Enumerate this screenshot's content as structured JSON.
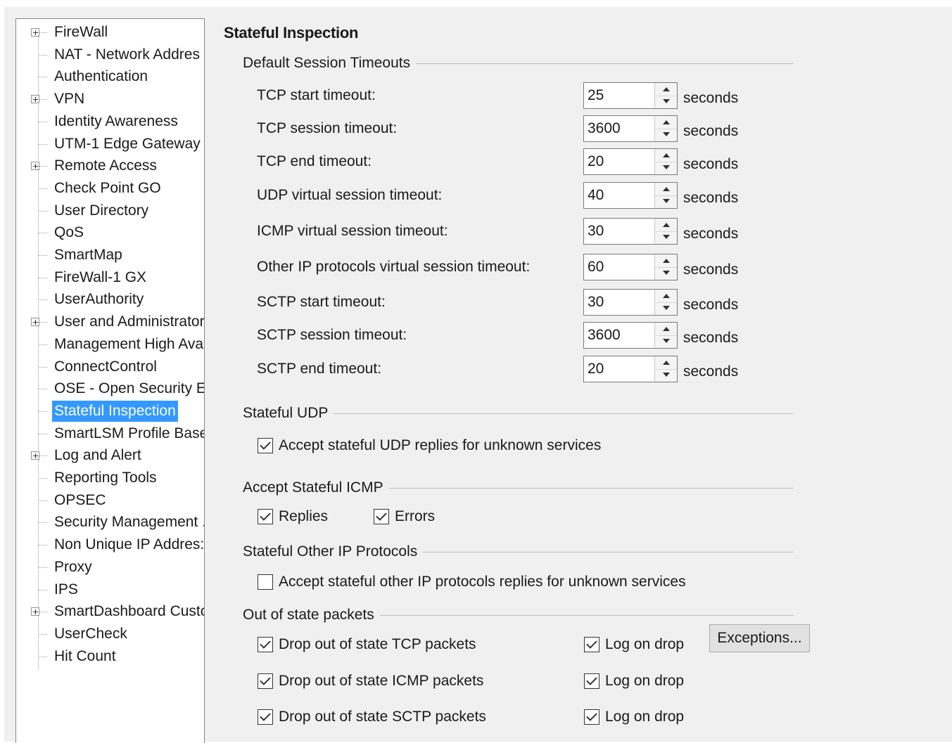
{
  "tree": {
    "items": [
      {
        "label": "FireWall",
        "expandable": true
      },
      {
        "label": "NAT - Network Addres",
        "expandable": false
      },
      {
        "label": "Authentication",
        "expandable": false
      },
      {
        "label": "VPN",
        "expandable": true
      },
      {
        "label": "Identity Awareness",
        "expandable": false
      },
      {
        "label": "UTM-1 Edge Gateway",
        "expandable": false
      },
      {
        "label": "Remote Access",
        "expandable": true
      },
      {
        "label": "Check Point GO",
        "expandable": false
      },
      {
        "label": "User Directory",
        "expandable": false
      },
      {
        "label": "QoS",
        "expandable": false
      },
      {
        "label": "SmartMap",
        "expandable": false
      },
      {
        "label": "FireWall-1 GX",
        "expandable": false
      },
      {
        "label": "UserAuthority",
        "expandable": false
      },
      {
        "label": "User and Administrator",
        "expandable": true
      },
      {
        "label": "Management High Ava",
        "expandable": false
      },
      {
        "label": "ConnectControl",
        "expandable": false
      },
      {
        "label": "OSE - Open Security E",
        "expandable": false
      },
      {
        "label": "Stateful Inspection",
        "expandable": false,
        "selected": true
      },
      {
        "label": "SmartLSM Profile Base",
        "expandable": false
      },
      {
        "label": "Log and Alert",
        "expandable": true
      },
      {
        "label": "Reporting Tools",
        "expandable": false
      },
      {
        "label": "OPSEC",
        "expandable": false
      },
      {
        "label": "Security Management .",
        "expandable": false
      },
      {
        "label": "Non Unique IP Addres:",
        "expandable": false
      },
      {
        "label": "Proxy",
        "expandable": false
      },
      {
        "label": "IPS",
        "expandable": false
      },
      {
        "label": "SmartDashboard Custc",
        "expandable": true
      },
      {
        "label": "UserCheck",
        "expandable": false
      },
      {
        "label": "Hit Count",
        "expandable": false
      }
    ]
  },
  "page_title": "Stateful Inspection",
  "timeouts": {
    "title": "Default Session Timeouts",
    "unit": "seconds",
    "fields": [
      {
        "label": "TCP start timeout:",
        "value": "25"
      },
      {
        "label": "TCP session timeout:",
        "value": "3600"
      },
      {
        "label": "TCP end timeout:",
        "value": "20"
      },
      {
        "label": "UDP virtual session timeout:",
        "value": "40"
      },
      {
        "label": "ICMP virtual session timeout:",
        "value": "30"
      },
      {
        "label": "Other IP protocols virtual session timeout:",
        "value": "60"
      },
      {
        "label": "SCTP start timeout:",
        "value": "30"
      },
      {
        "label": "SCTP session timeout:",
        "value": "3600"
      },
      {
        "label": "SCTP end timeout:",
        "value": "20"
      }
    ]
  },
  "stateful_udp": {
    "title": "Stateful UDP",
    "accept_label": "Accept stateful UDP replies for unknown services",
    "accept_checked": true
  },
  "stateful_icmp": {
    "title": "Accept Stateful ICMP",
    "replies_label": "Replies",
    "replies_checked": true,
    "errors_label": "Errors",
    "errors_checked": true
  },
  "stateful_other": {
    "title": "Stateful Other IP Protocols",
    "accept_label": "Accept stateful other IP protocols replies for unknown services",
    "accept_checked": false
  },
  "out_of_state": {
    "title": "Out of state packets",
    "rows": [
      {
        "drop_label": "Drop out of state TCP packets",
        "drop_checked": true,
        "log_label": "Log on drop",
        "log_checked": true
      },
      {
        "drop_label": "Drop out of state ICMP packets",
        "drop_checked": true,
        "log_label": "Log on drop",
        "log_checked": true
      },
      {
        "drop_label": "Drop out of state SCTP packets",
        "drop_checked": true,
        "log_label": "Log on drop",
        "log_checked": true
      }
    ],
    "exceptions_label": "Exceptions..."
  }
}
